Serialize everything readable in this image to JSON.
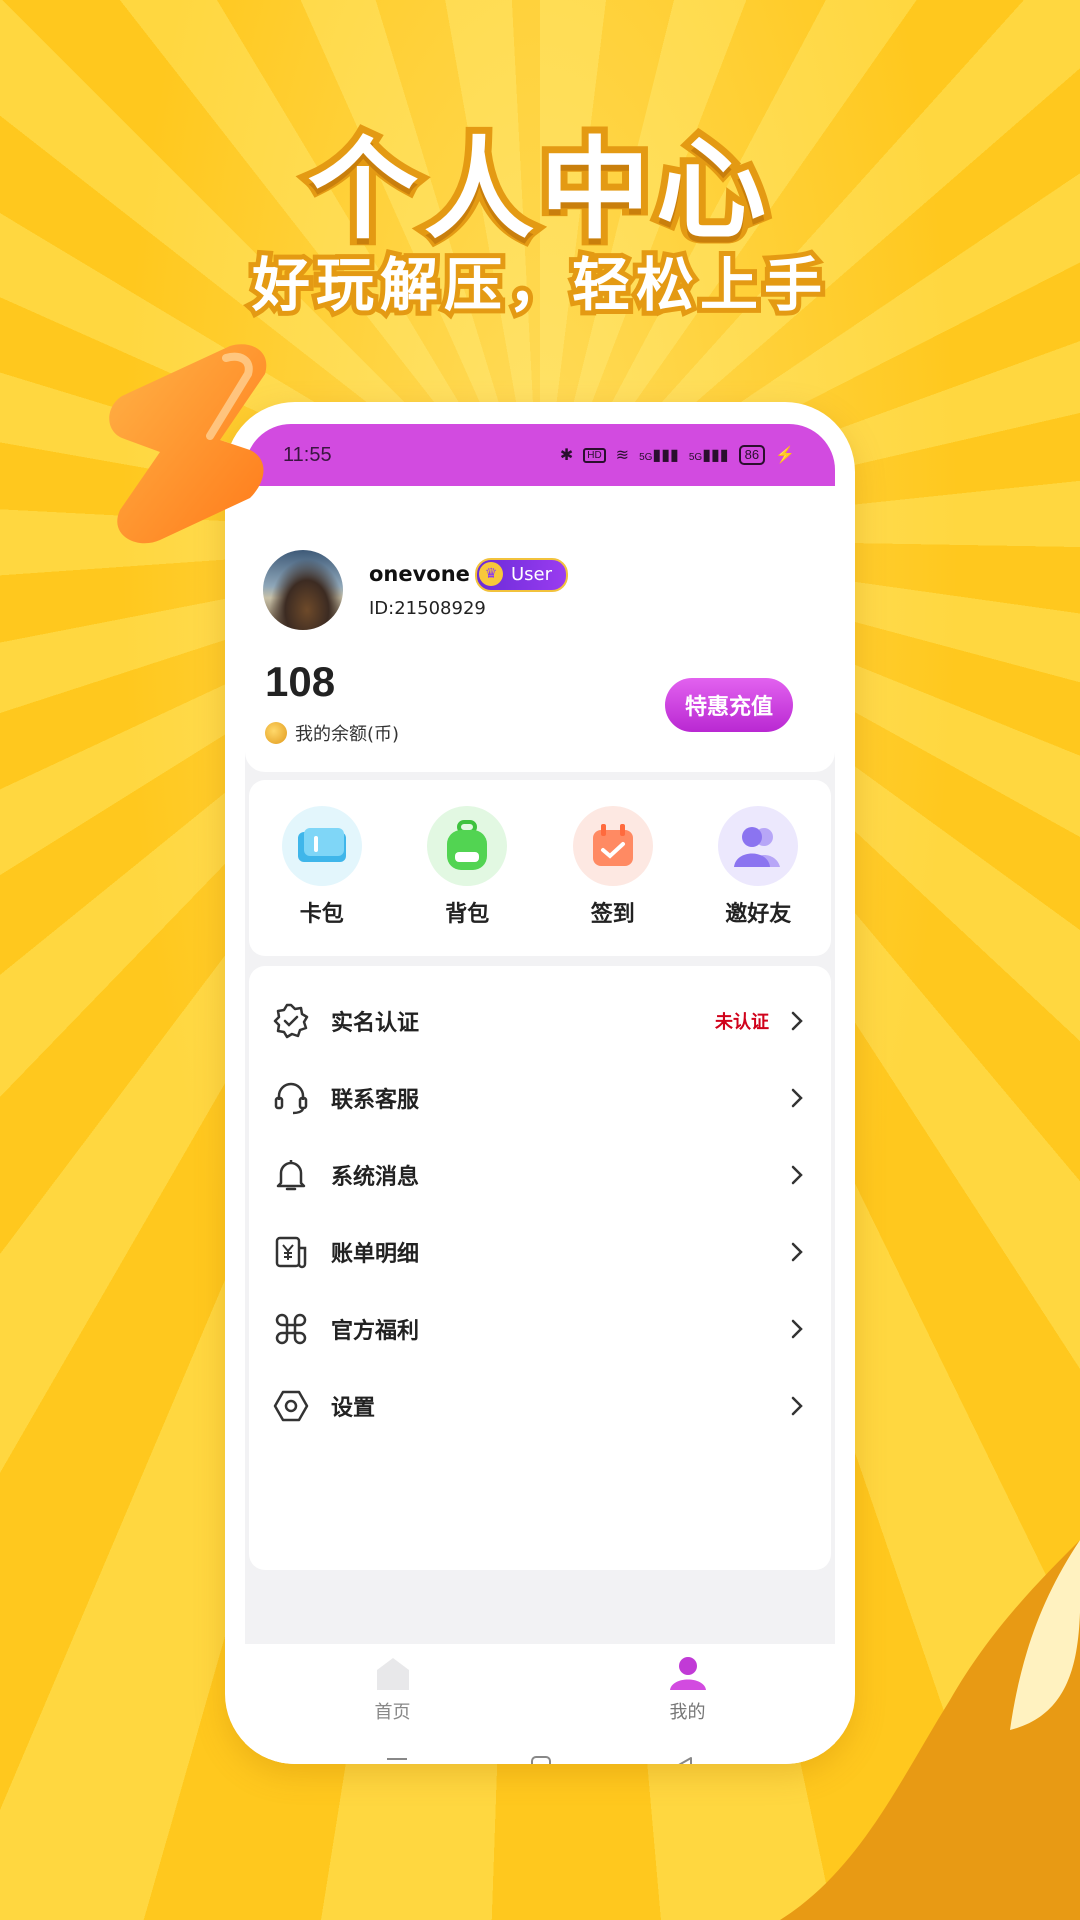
{
  "promo": {
    "title": "个人中心",
    "subtitle": "好玩解压，轻松上手"
  },
  "status_bar": {
    "time": "11:55",
    "battery": "86",
    "network_a": "5G",
    "network_b": "5G"
  },
  "profile": {
    "username": "onevone",
    "badge": "User",
    "user_id": "ID:21508929",
    "balance": "108",
    "balance_label": "我的余额(币)",
    "recharge_label": "特惠充值"
  },
  "quick_actions": [
    {
      "label": "卡包",
      "icon": "card-wallet-icon"
    },
    {
      "label": "背包",
      "icon": "backpack-icon"
    },
    {
      "label": "签到",
      "icon": "calendar-check-icon"
    },
    {
      "label": "邀好友",
      "icon": "invite-friends-icon"
    }
  ],
  "menu": [
    {
      "label": "实名认证",
      "icon": "verified-badge-icon",
      "status": "未认证"
    },
    {
      "label": "联系客服",
      "icon": "headset-icon",
      "status": ""
    },
    {
      "label": "系统消息",
      "icon": "bell-icon",
      "status": ""
    },
    {
      "label": "账单明细",
      "icon": "bill-icon",
      "status": ""
    },
    {
      "label": "官方福利",
      "icon": "command-icon",
      "status": ""
    },
    {
      "label": "设置",
      "icon": "settings-hexagon-icon",
      "status": ""
    }
  ],
  "tabs": [
    {
      "label": "首页",
      "icon": "home-icon",
      "active": false
    },
    {
      "label": "我的",
      "icon": "profile-icon",
      "active": true
    }
  ],
  "colors": {
    "accent": "#d24be0",
    "warning": "#d0021b",
    "background": "#ffcf2e"
  }
}
